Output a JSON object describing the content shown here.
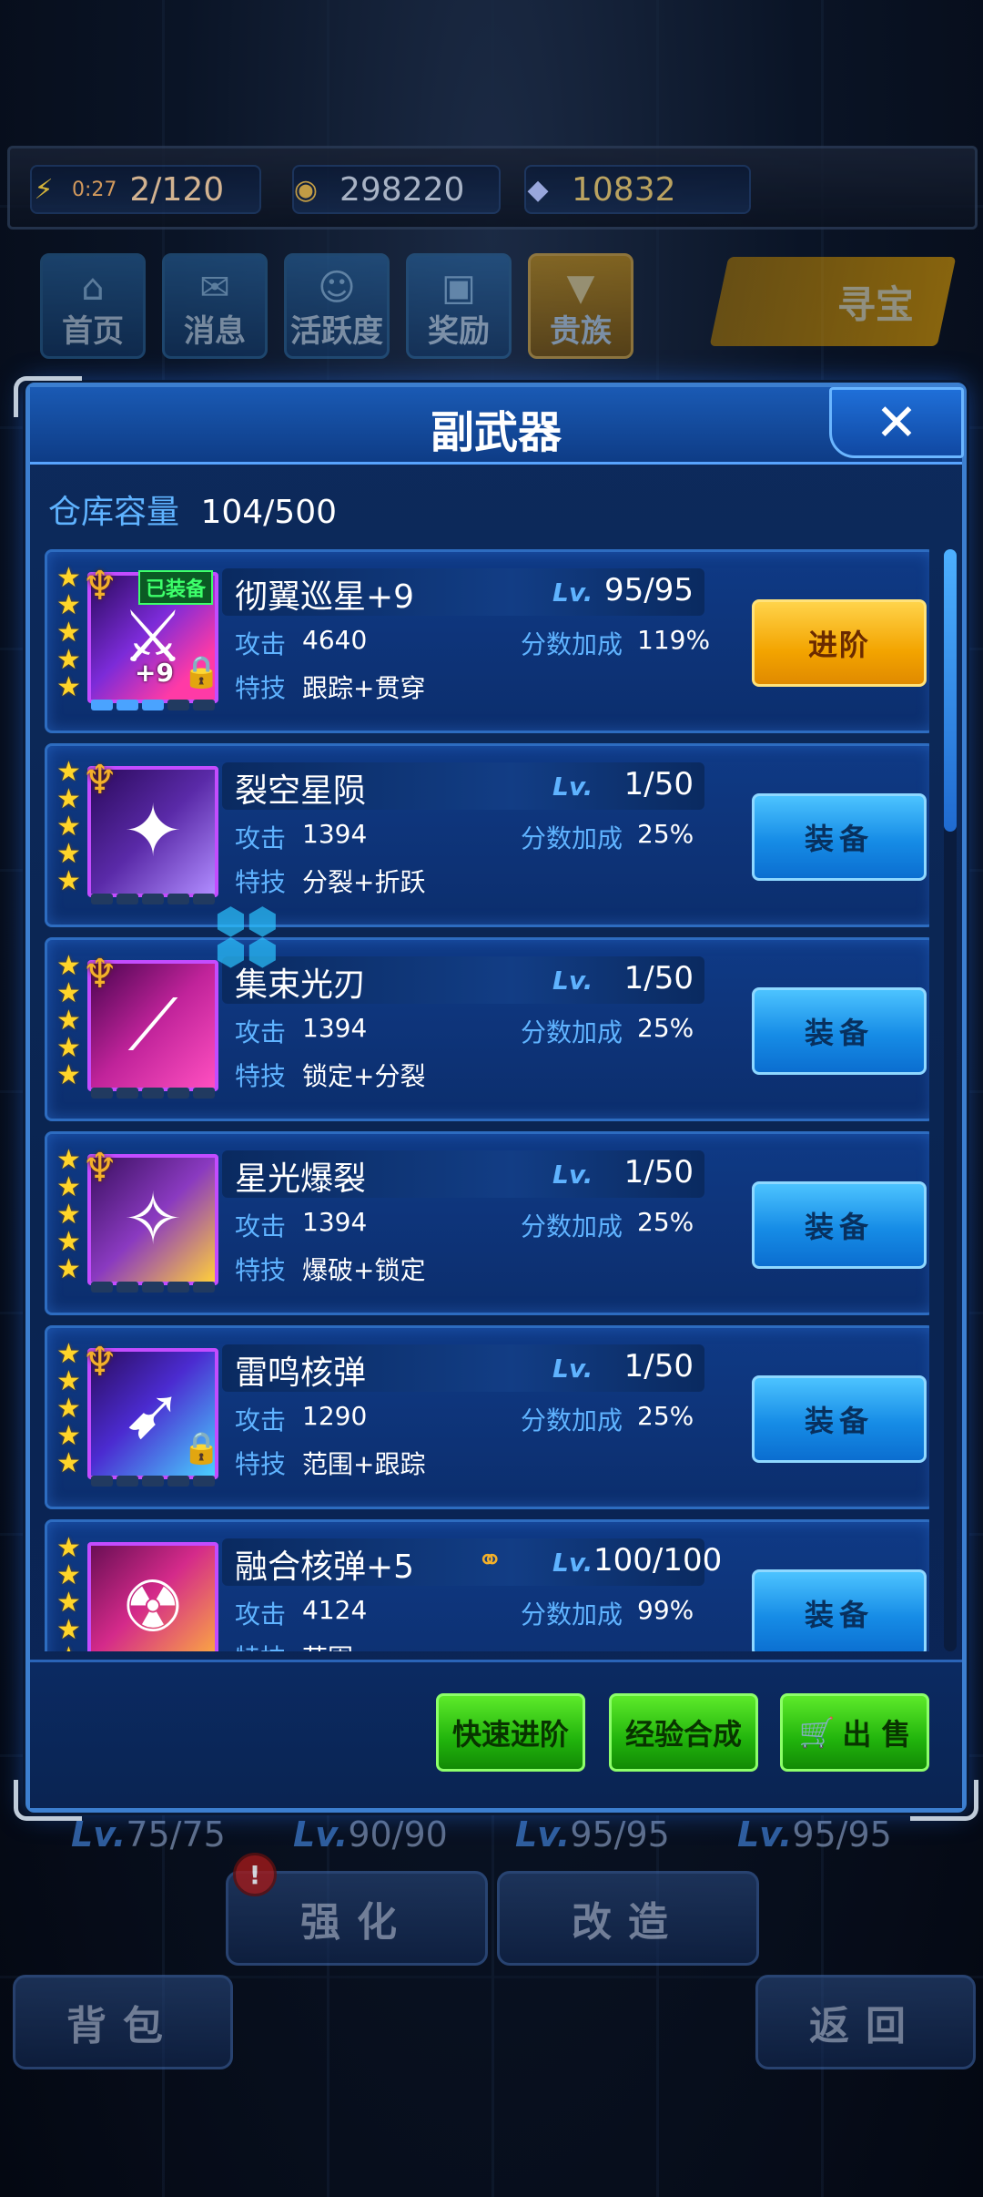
{
  "status": {
    "timer": "0:27",
    "energy": "2/120",
    "coins": "298220",
    "gems": "10832"
  },
  "topnav": [
    {
      "label": "首页"
    },
    {
      "label": "消息"
    },
    {
      "label": "活跃度"
    },
    {
      "label": "奖励"
    },
    {
      "label": "贵族"
    }
  ],
  "treasure_label": "寻宝",
  "panel": {
    "title": "副武器",
    "close": "✕",
    "capacity_label": "仓库容量",
    "capacity_value": "104/500"
  },
  "labels": {
    "lv": "Lv.",
    "attack": "攻击",
    "bonus": "分数加成",
    "skill": "特技",
    "equipped": "已装备"
  },
  "items": [
    {
      "name": "彻翼巡星+9",
      "lv": "95/95",
      "attack": "4640",
      "bonus": "119%",
      "skill": "跟踪+贯穿",
      "action": "进阶",
      "tag": "+9"
    },
    {
      "name": "裂空星陨",
      "lv": "1/50",
      "attack": "1394",
      "bonus": "25%",
      "skill": "分裂+折跃",
      "action": "装备"
    },
    {
      "name": "集束光刃",
      "lv": "1/50",
      "attack": "1394",
      "bonus": "25%",
      "skill": "锁定+分裂",
      "action": "装备"
    },
    {
      "name": "星光爆裂",
      "lv": "1/50",
      "attack": "1394",
      "bonus": "25%",
      "skill": "爆破+锁定",
      "action": "装备"
    },
    {
      "name": "雷鸣核弹",
      "lv": "1/50",
      "attack": "1290",
      "bonus": "25%",
      "skill": "范围+跟踪",
      "action": "装备"
    },
    {
      "name": "融合核弹+5",
      "lv": "100/100",
      "attack": "4124",
      "bonus": "99%",
      "skill": "范围",
      "action": "装备"
    }
  ],
  "footer": {
    "quick_advance": "快速进阶",
    "exp_merge": "经验合成",
    "sell": "出 售"
  },
  "background": {
    "levels": [
      "75/75",
      "90/90",
      "95/95",
      "95/95"
    ],
    "strengthen": "强化",
    "modify": "改造",
    "bag": "背包",
    "back": "返回",
    "alert": "!"
  }
}
